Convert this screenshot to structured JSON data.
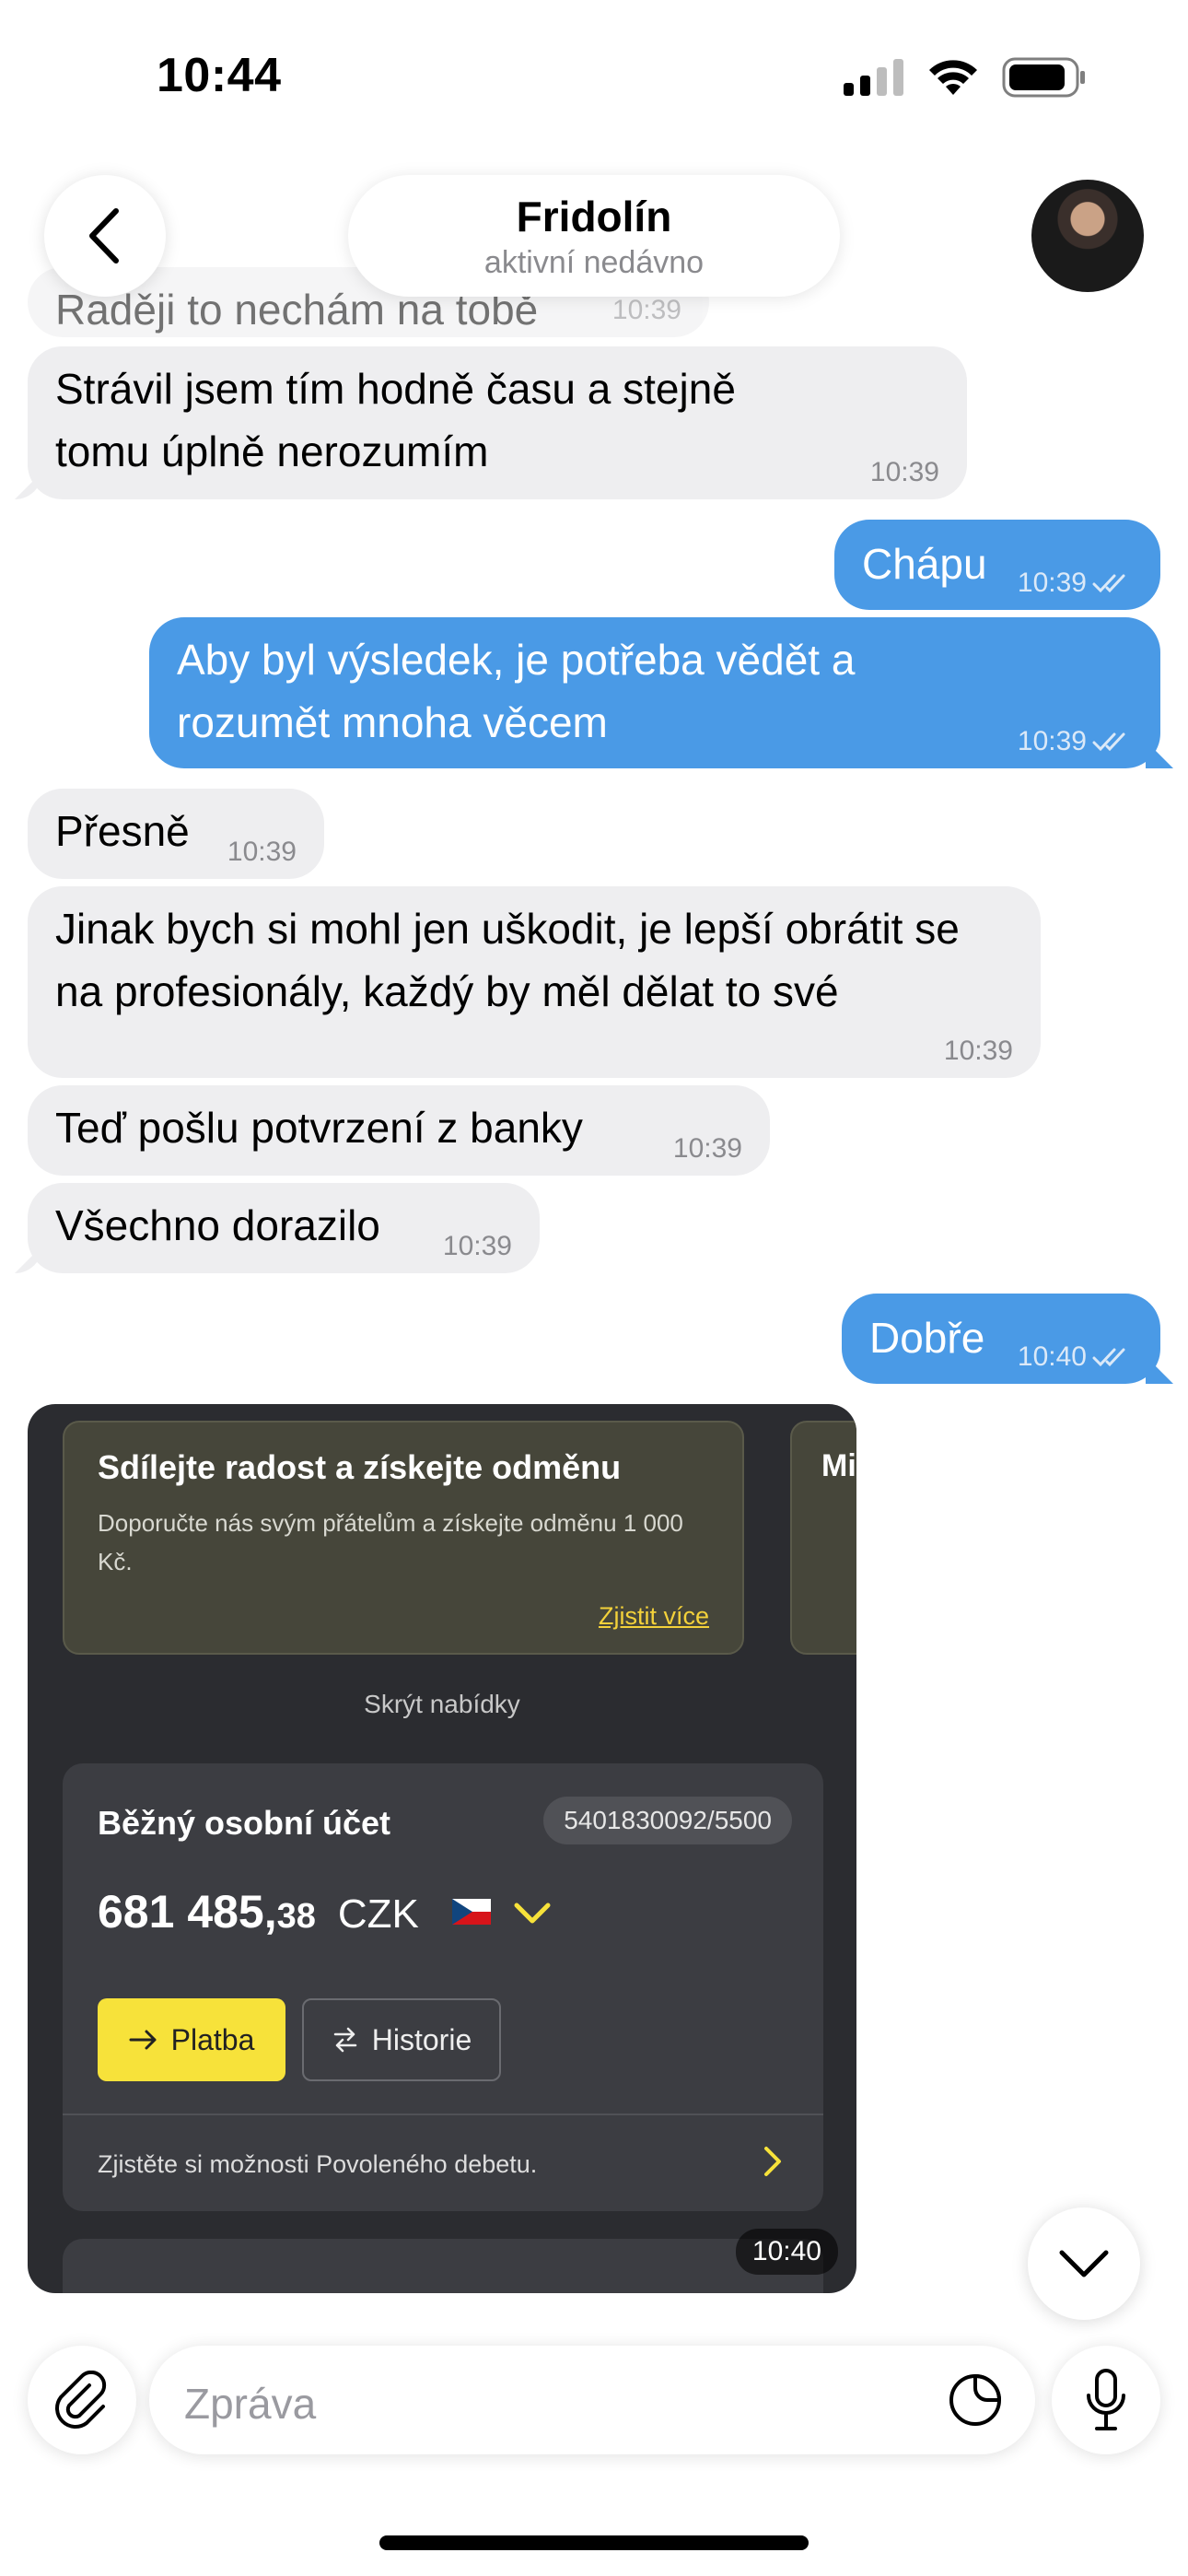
{
  "status_bar": {
    "time": "10:44"
  },
  "header": {
    "contact_name": "Fridolín",
    "contact_status": "aktivní nedávno"
  },
  "messages": [
    {
      "dir": "in",
      "text": "Raději to nechám na tobě",
      "time": "10:39"
    },
    {
      "dir": "in",
      "text": "Strávil jsem tím hodně času a stejně tomu úplně nerozumím",
      "time": "10:39"
    },
    {
      "dir": "out",
      "text": "Chápu",
      "time": "10:39"
    },
    {
      "dir": "out",
      "text": "Aby byl výsledek, je potřeba vědět a rozumět mnoha věcem",
      "time": "10:39"
    },
    {
      "dir": "in",
      "text": "Přesně",
      "time": "10:39"
    },
    {
      "dir": "in",
      "text": "Jinak bych si mohl jen uškodit, je lepší obrátit se na profesionály, každý by měl dělat to své",
      "time": "10:39"
    },
    {
      "dir": "in",
      "text": "Teď pošlu potvrzení z banky",
      "time": "10:39"
    },
    {
      "dir": "in",
      "text": "Všechno dorazilo",
      "time": "10:39"
    },
    {
      "dir": "out",
      "text": "Dobře",
      "time": "10:40"
    }
  ],
  "photo_message": {
    "time": "10:40",
    "promo_title": "Sdílejte radost a získejte odměnu",
    "promo_text": "Doporučte nás svým přátelům a získejte odměnu 1 000 Kč.",
    "promo_link": "Zjistit více",
    "promo2_partial": "Mi",
    "hide_offers": "Skrýt nabídky",
    "account_name": "Běžný osobní účet",
    "account_number": "5401830092/5500",
    "balance_main": "681 485,",
    "balance_decimals": "38",
    "currency": "CZK",
    "pay_button": "Platba",
    "history_button": "Historie",
    "overdraft_text": "Zjistěte si možnosti Povoleného debetu."
  },
  "composer": {
    "placeholder": "Zpráva"
  },
  "colors": {
    "outgoing": "#4a9ae6",
    "incoming": "#eeeef0",
    "bank_accent": "#f7e23a"
  }
}
